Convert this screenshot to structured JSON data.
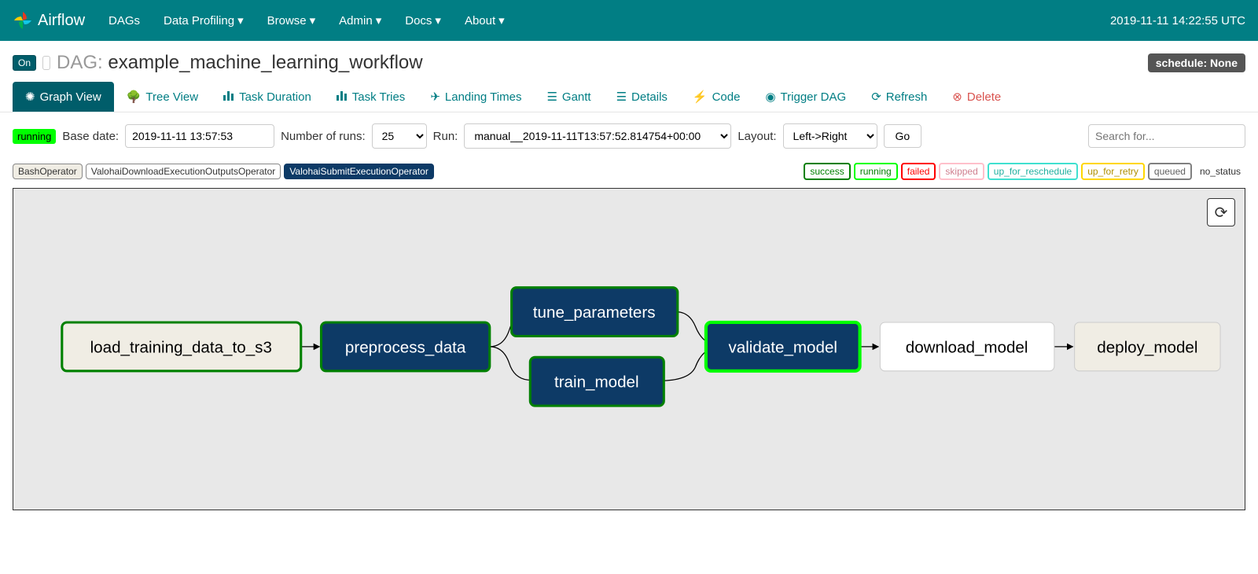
{
  "navbar": {
    "brand": "Airflow",
    "links": [
      "DAGs",
      "Data Profiling",
      "Browse",
      "Admin",
      "Docs",
      "About"
    ],
    "clock": "2019-11-11 14:22:55 UTC"
  },
  "header": {
    "toggle": "On",
    "dag_label": "DAG:",
    "dag_name": "example_machine_learning_workflow",
    "schedule_badge": "schedule: None"
  },
  "tabs": {
    "graph_view": "Graph View",
    "tree_view": "Tree View",
    "task_duration": "Task Duration",
    "task_tries": "Task Tries",
    "landing_times": "Landing Times",
    "gantt": "Gantt",
    "details": "Details",
    "code": "Code",
    "trigger_dag": "Trigger DAG",
    "refresh": "Refresh",
    "delete": "Delete"
  },
  "controls": {
    "running_badge": "running",
    "base_date_label": "Base date:",
    "base_date_value": "2019-11-11 13:57:53",
    "num_runs_label": "Number of runs:",
    "num_runs_value": "25",
    "run_label": "Run:",
    "run_value": "manual__2019-11-11T13:57:52.814754+00:00",
    "layout_label": "Layout:",
    "layout_value": "Left->Right",
    "go": "Go",
    "search_placeholder": "Search for..."
  },
  "operators": {
    "bash": "BashOperator",
    "valohai_download": "ValohaiDownloadExecutionOutputsOperator",
    "valohai_submit": "ValohaiSubmitExecutionOperator"
  },
  "states": {
    "success": "success",
    "running": "running",
    "failed": "failed",
    "skipped": "skipped",
    "up_for_reschedule": "up_for_reschedule",
    "up_for_retry": "up_for_retry",
    "queued": "queued",
    "no_status": "no_status"
  },
  "nodes": {
    "load": "load_training_data_to_s3",
    "preprocess": "preprocess_data",
    "tune": "tune_parameters",
    "train": "train_model",
    "validate": "validate_model",
    "download": "download_model",
    "deploy": "deploy_model"
  },
  "colors": {
    "accent": "#017e84",
    "navy": "#0d3a66",
    "success": "#008000",
    "running": "#00ff00",
    "failed": "#ff0000"
  }
}
